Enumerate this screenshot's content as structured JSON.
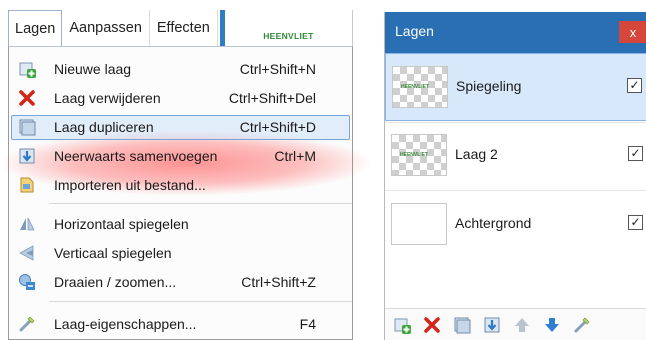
{
  "menubar": {
    "tabs": [
      {
        "label": "Lagen"
      },
      {
        "label": "Aanpassen"
      },
      {
        "label": "Effecten"
      }
    ],
    "brand": "HEENVLIET"
  },
  "menu": {
    "items": [
      {
        "label": "Nieuwe laag",
        "shortcut": "Ctrl+Shift+N",
        "icon": "new-layer-icon"
      },
      {
        "label": "Laag verwijderen",
        "shortcut": "Ctrl+Shift+Del",
        "icon": "delete-layer-icon"
      },
      {
        "label": "Laag dupliceren",
        "shortcut": "Ctrl+Shift+D",
        "icon": "duplicate-layer-icon"
      },
      {
        "label": "Neerwaarts samenvoegen",
        "shortcut": "Ctrl+M",
        "icon": "merge-down-icon"
      },
      {
        "label": "Importeren uit bestand...",
        "shortcut": "",
        "icon": "import-file-icon"
      },
      {
        "label": "Horizontaal spiegelen",
        "shortcut": "",
        "icon": "flip-horizontal-icon"
      },
      {
        "label": "Verticaal spiegelen",
        "shortcut": "",
        "icon": "flip-vertical-icon"
      },
      {
        "label": "Draaien / zoomen...",
        "shortcut": "Ctrl+Shift+Z",
        "icon": "rotate-zoom-icon"
      },
      {
        "label": "Laag-eigenschappen...",
        "shortcut": "F4",
        "icon": "layer-properties-icon"
      }
    ],
    "highlighted_index": 2
  },
  "panel": {
    "title": "Lagen",
    "close_label": "x",
    "layers": [
      {
        "name": "Spiegeling",
        "visible": true,
        "selected": true,
        "thumb_text": "HEENVLIET"
      },
      {
        "name": "Laag 2",
        "visible": true,
        "selected": false,
        "thumb_text": "HEENVLIET"
      },
      {
        "name": "Achtergrond",
        "visible": true,
        "selected": false,
        "thumb_text": ""
      }
    ],
    "check_glyph": "✓",
    "toolbar": [
      "add-layer-icon",
      "delete-layer-icon",
      "duplicate-layer-icon",
      "merge-down-icon",
      "move-up-icon",
      "move-down-icon",
      "layer-properties-icon"
    ]
  },
  "colors": {
    "accent": "#2a6eb3",
    "close": "#d6473b",
    "highlight_glow": "#ff3c3c",
    "brand": "#2f8a3a"
  }
}
